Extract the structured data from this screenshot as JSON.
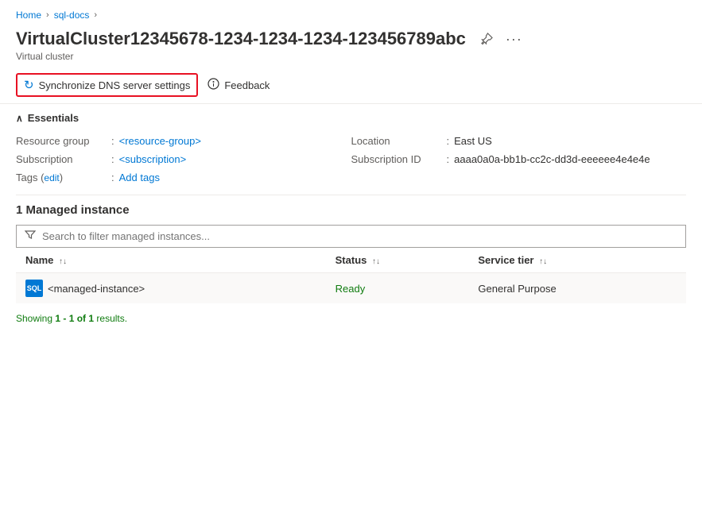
{
  "breadcrumb": {
    "items": [
      {
        "label": "Home",
        "href": "#"
      },
      {
        "label": "sql-docs",
        "href": "#"
      }
    ]
  },
  "header": {
    "title": "VirtualCluster12345678-1234-1234-1234-123456789abc",
    "subtitle": "Virtual cluster",
    "pin_label": "Pin to dashboard",
    "more_label": "More options"
  },
  "toolbar": {
    "sync_label": "Synchronize DNS server settings",
    "feedback_label": "Feedback"
  },
  "essentials": {
    "title": "Essentials",
    "rows": [
      {
        "label": "Resource group",
        "sep": ":",
        "value": "<resource-group>",
        "is_link": true
      },
      {
        "label": "Location",
        "sep": ":",
        "value": "East US",
        "is_link": false
      },
      {
        "label": "Subscription",
        "sep": ":",
        "value": "<subscription>",
        "is_link": true
      },
      {
        "label": "Subscription ID",
        "sep": ":",
        "value": "aaaa0a0a-bb1b-cc2c-dd3d-eeeeee4e4e4e",
        "is_link": false
      },
      {
        "label": "Tags",
        "sep": ":",
        "value": "Add tags",
        "is_link": true,
        "edit_text": "edit",
        "has_edit": true
      }
    ]
  },
  "managed": {
    "title": "1 Managed instance",
    "search_placeholder": "Search to filter managed instances...",
    "columns": [
      {
        "label": "Name",
        "key": "name"
      },
      {
        "label": "Status",
        "key": "status"
      },
      {
        "label": "Service tier",
        "key": "tier"
      }
    ],
    "rows": [
      {
        "name": "<managed-instance>",
        "status": "Ready",
        "tier": "General Purpose"
      }
    ],
    "results": "Showing 1 - 1 of 1 results."
  }
}
